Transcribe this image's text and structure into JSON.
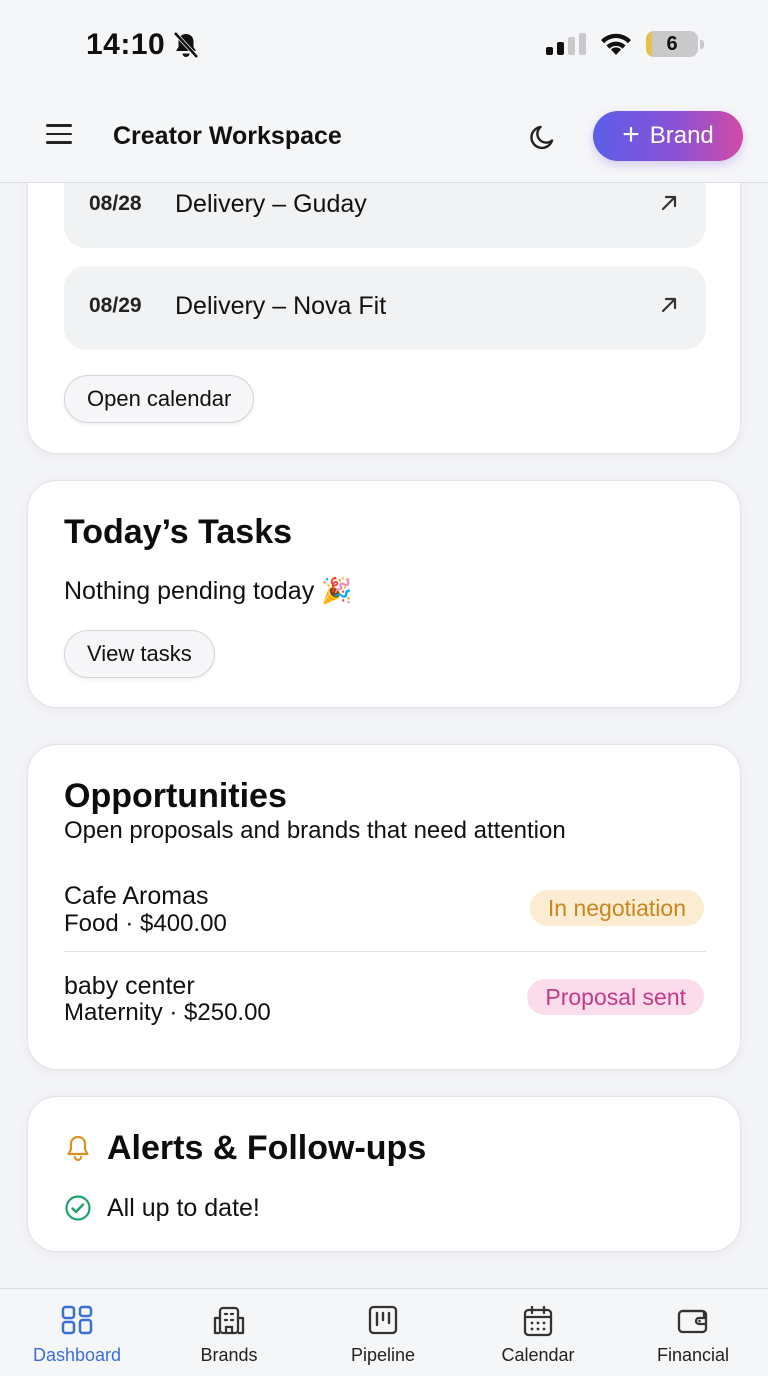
{
  "status_bar": {
    "time": "14:10",
    "battery": "6"
  },
  "header": {
    "title": "Creator Workspace",
    "brand_button": "Brand"
  },
  "calendar": {
    "items": [
      {
        "date": "08/28",
        "label": "Delivery – Guday"
      },
      {
        "date": "08/29",
        "label": "Delivery – Nova Fit"
      }
    ],
    "open_button": "Open calendar"
  },
  "tasks": {
    "title": "Today’s Tasks",
    "empty_text": "Nothing pending today 🎉",
    "view_button": "View tasks"
  },
  "opportunities": {
    "title": "Opportunities",
    "subtitle": "Open proposals and brands that need attention",
    "items": [
      {
        "name": "Cafe Aromas",
        "meta": "Food · $400.00",
        "status": "In negotiation"
      },
      {
        "name": "baby center",
        "meta": "Maternity · $250.00",
        "status": "Proposal sent"
      }
    ]
  },
  "alerts": {
    "title": "Alerts & Follow-ups",
    "status": "All up to date!"
  },
  "nav": {
    "items": [
      {
        "label": "Dashboard",
        "icon": "dashboard-icon"
      },
      {
        "label": "Brands",
        "icon": "building-icon"
      },
      {
        "label": "Pipeline",
        "icon": "kanban-icon"
      },
      {
        "label": "Calendar",
        "icon": "calendar-icon"
      },
      {
        "label": "Financial",
        "icon": "wallet-icon"
      }
    ],
    "active": "Dashboard"
  },
  "colors": {
    "accent": "#3b6fd6",
    "negotiation": "#c9861e",
    "proposal": "#c23a8a",
    "success": "#22a06b",
    "bell": "#d99223"
  }
}
